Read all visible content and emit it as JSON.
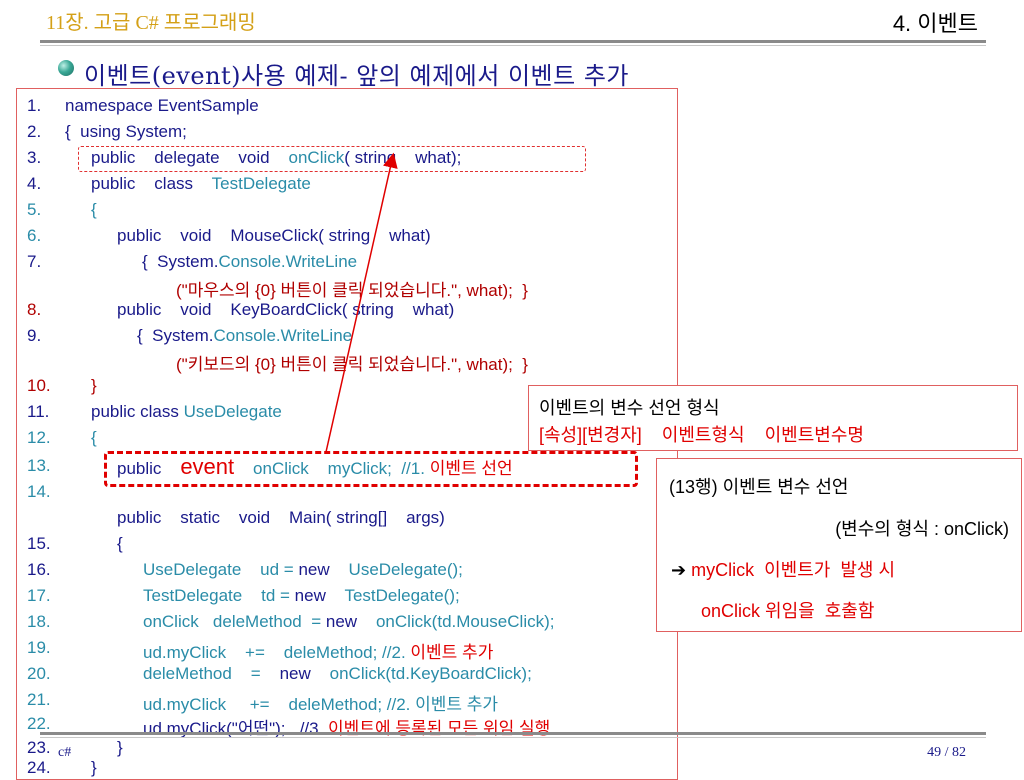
{
  "header": {
    "chapter": "11장. 고급 C# 프로그래밍",
    "section": "4. 이벤트"
  },
  "heading": "이벤트(event)사용 예제- 앞의 예제에서 이벤트 추가",
  "code": {
    "l1": {
      "num": "1.",
      "text": "namespace EventSample"
    },
    "l2": {
      "num": "2.",
      "text": "{  using System;"
    },
    "l3": {
      "num": "3.",
      "a": "public    delegate    void    ",
      "b": "onClick",
      "c": "( string    what);"
    },
    "l4": {
      "num": "4.",
      "a": "public    class    ",
      "b": "TestDelegate"
    },
    "l5": {
      "num": "5.",
      "text": "{"
    },
    "l6": {
      "num": "6.",
      "text": "public    void    MouseClick( string    what)"
    },
    "l7": {
      "num": "7.",
      "a": "{  System.",
      "b": "Console.WriteLine"
    },
    "l7b": {
      "text": "(\"마우스의 {0} 버튼이 클릭 되었습니다.\", what);  }"
    },
    "l8": {
      "num": "8.",
      "text": "public    void    KeyBoardClick( string    what)"
    },
    "l9": {
      "num": "9.",
      "a": "{  System.",
      "b": "Console.WriteLine"
    },
    "l9b": {
      "text": "(\"키보드의 {0} 버튼이 클릭 되었습니다.\", what);  }"
    },
    "l10": {
      "num": "10.",
      "text": "}"
    },
    "l11": {
      "num": "11.",
      "a": "public class ",
      "b": "UseDelegate"
    },
    "l12": {
      "num": "12.",
      "text": "{"
    },
    "l13": {
      "num": "13.",
      "a": "public    ",
      "b": "event",
      "c": "    onClick    myClick;  //1. ",
      "d": "이벤트 선언"
    },
    "l14": {
      "num": "14."
    },
    "l14b": {
      "text": "public    static    void    Main( string[]    args)"
    },
    "l15": {
      "num": "15.",
      "text": "{"
    },
    "l16": {
      "num": "16.",
      "a": "UseDelegate    ud = ",
      "b": "new",
      "c": "    UseDelegate();"
    },
    "l17": {
      "num": "17.",
      "a": "TestDelegate    td = ",
      "b": "new",
      "c": "    TestDelegate();"
    },
    "l18": {
      "num": "18.",
      "a": "onClick   deleMethod  = ",
      "b": "new",
      "c": "    onClick(td.MouseClick);"
    },
    "l19": {
      "num": "19.",
      "a": "ud.myClick    +=    deleMethod; //2. ",
      "b": "이벤트 추가"
    },
    "l20": {
      "num": "20.",
      "a": "deleMethod    =    ",
      "b": "new",
      "c": "    onClick(td.KeyBoardClick);"
    },
    "l21": {
      "num": "21.",
      "text": "ud.myClick     +=    deleMethod; //2. 이벤트 추가"
    },
    "l22": {
      "num": "22.",
      "a": "ud.myClick(\"어떤\");   //3. ",
      "b": "이벤트에 등록된 모든 위임 실행"
    },
    "l23": {
      "num": "23.",
      "text": "}"
    },
    "l24": {
      "num": "24.",
      "text": "}"
    }
  },
  "callout1": {
    "title": "이벤트의 변수 선언 형식",
    "format": "[속성][변경자]    이벤트형식    이벤트변수명"
  },
  "callout2": {
    "line1": "(13행) 이벤트 변수 선언",
    "line2": "(변수의 형식 : onClick)",
    "arrow": "➔",
    "line3": " myClick  이벤트가  발생 시",
    "line4": "onClick 위임을  호출함"
  },
  "footer": {
    "left": "c#",
    "page": "49 / 82"
  },
  "colors": {
    "code": "#1a1a8a",
    "type": "#2a8ca8",
    "highlight": "#e00000",
    "chapter": "#d4a017"
  }
}
